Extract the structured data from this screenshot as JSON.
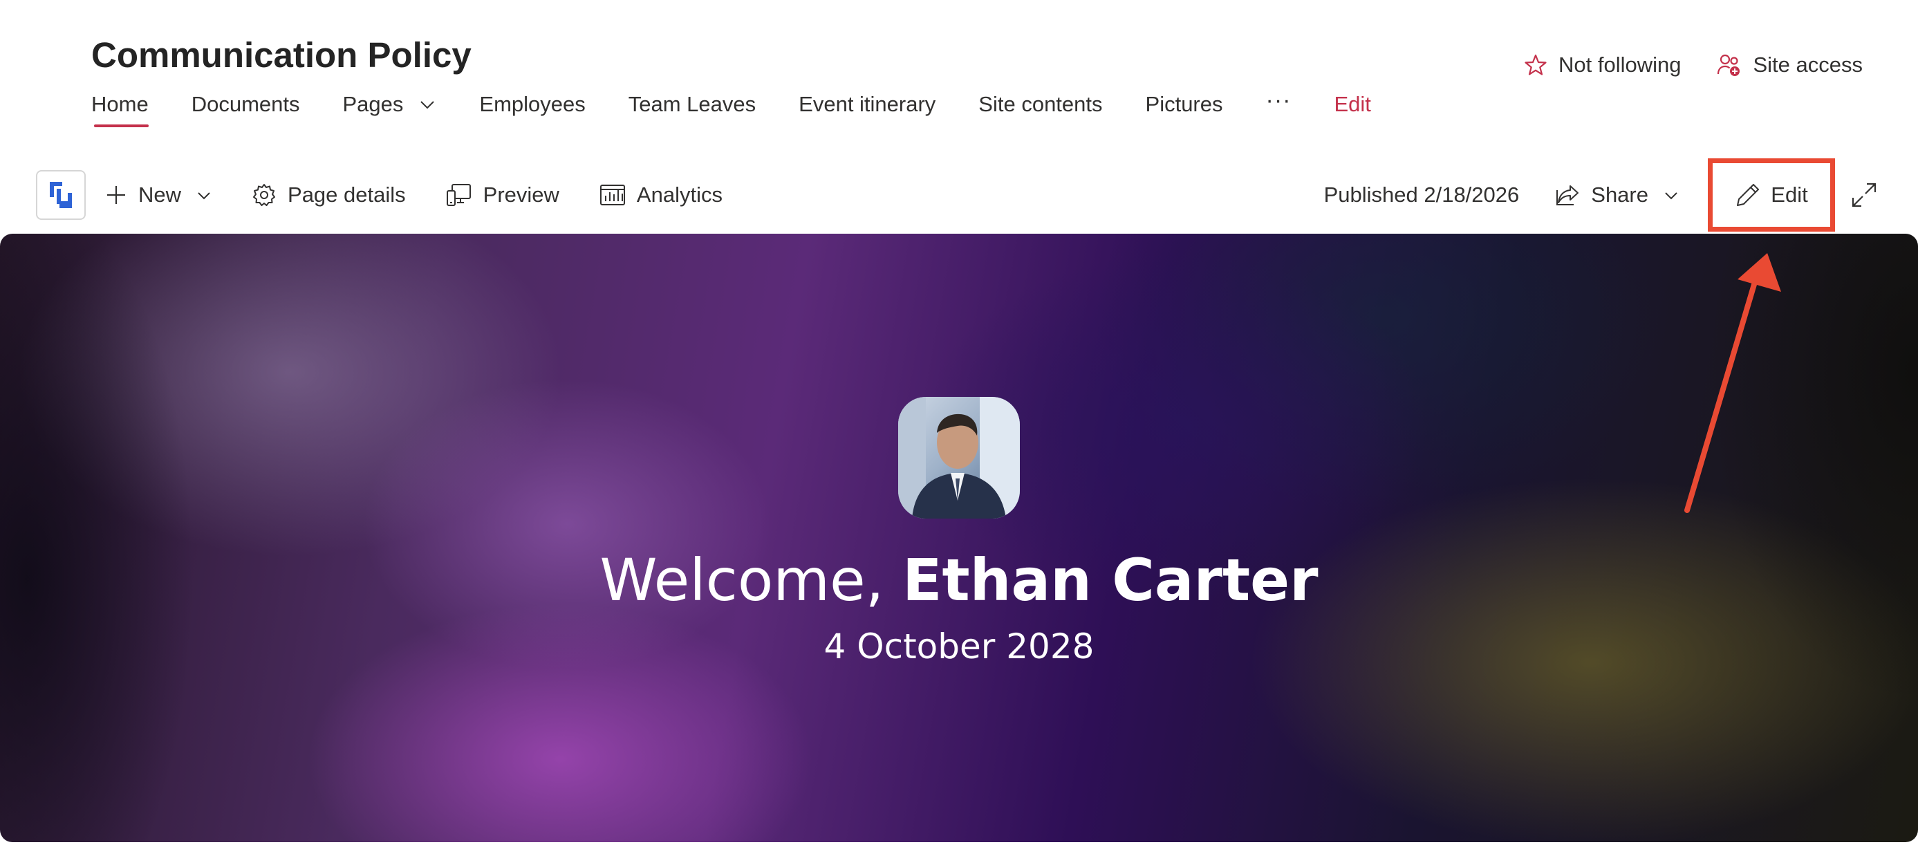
{
  "site": {
    "title": "Communication Policy",
    "nav": [
      {
        "label": "Home",
        "active": true
      },
      {
        "label": "Documents"
      },
      {
        "label": "Pages",
        "has_dropdown": true
      },
      {
        "label": "Employees"
      },
      {
        "label": "Team Leaves"
      },
      {
        "label": "Event itinerary"
      },
      {
        "label": "Site contents"
      },
      {
        "label": "Pictures"
      }
    ],
    "nav_more": "···",
    "nav_edit": "Edit",
    "follow_label": "Not following",
    "site_access_label": "Site access"
  },
  "commandbar": {
    "new_label": "New",
    "page_details_label": "Page details",
    "preview_label": "Preview",
    "analytics_label": "Analytics",
    "published": "Published 2/18/2026",
    "share_label": "Share",
    "edit_label": "Edit"
  },
  "hero": {
    "greeting": "Welcome, ",
    "user_name": "Ethan Carter",
    "date": "4 October 2028"
  },
  "colors": {
    "accent": "#c4314b",
    "annotation": "#e94a33"
  },
  "icons": {
    "follow": "star-icon",
    "site_access": "people-icon",
    "app": "app-logo-icon",
    "new": "plus-icon",
    "page_details": "gear-icon",
    "preview": "devices-icon",
    "analytics": "chart-icon",
    "share": "share-icon",
    "edit": "pencil-icon",
    "expand": "expand-icon"
  }
}
